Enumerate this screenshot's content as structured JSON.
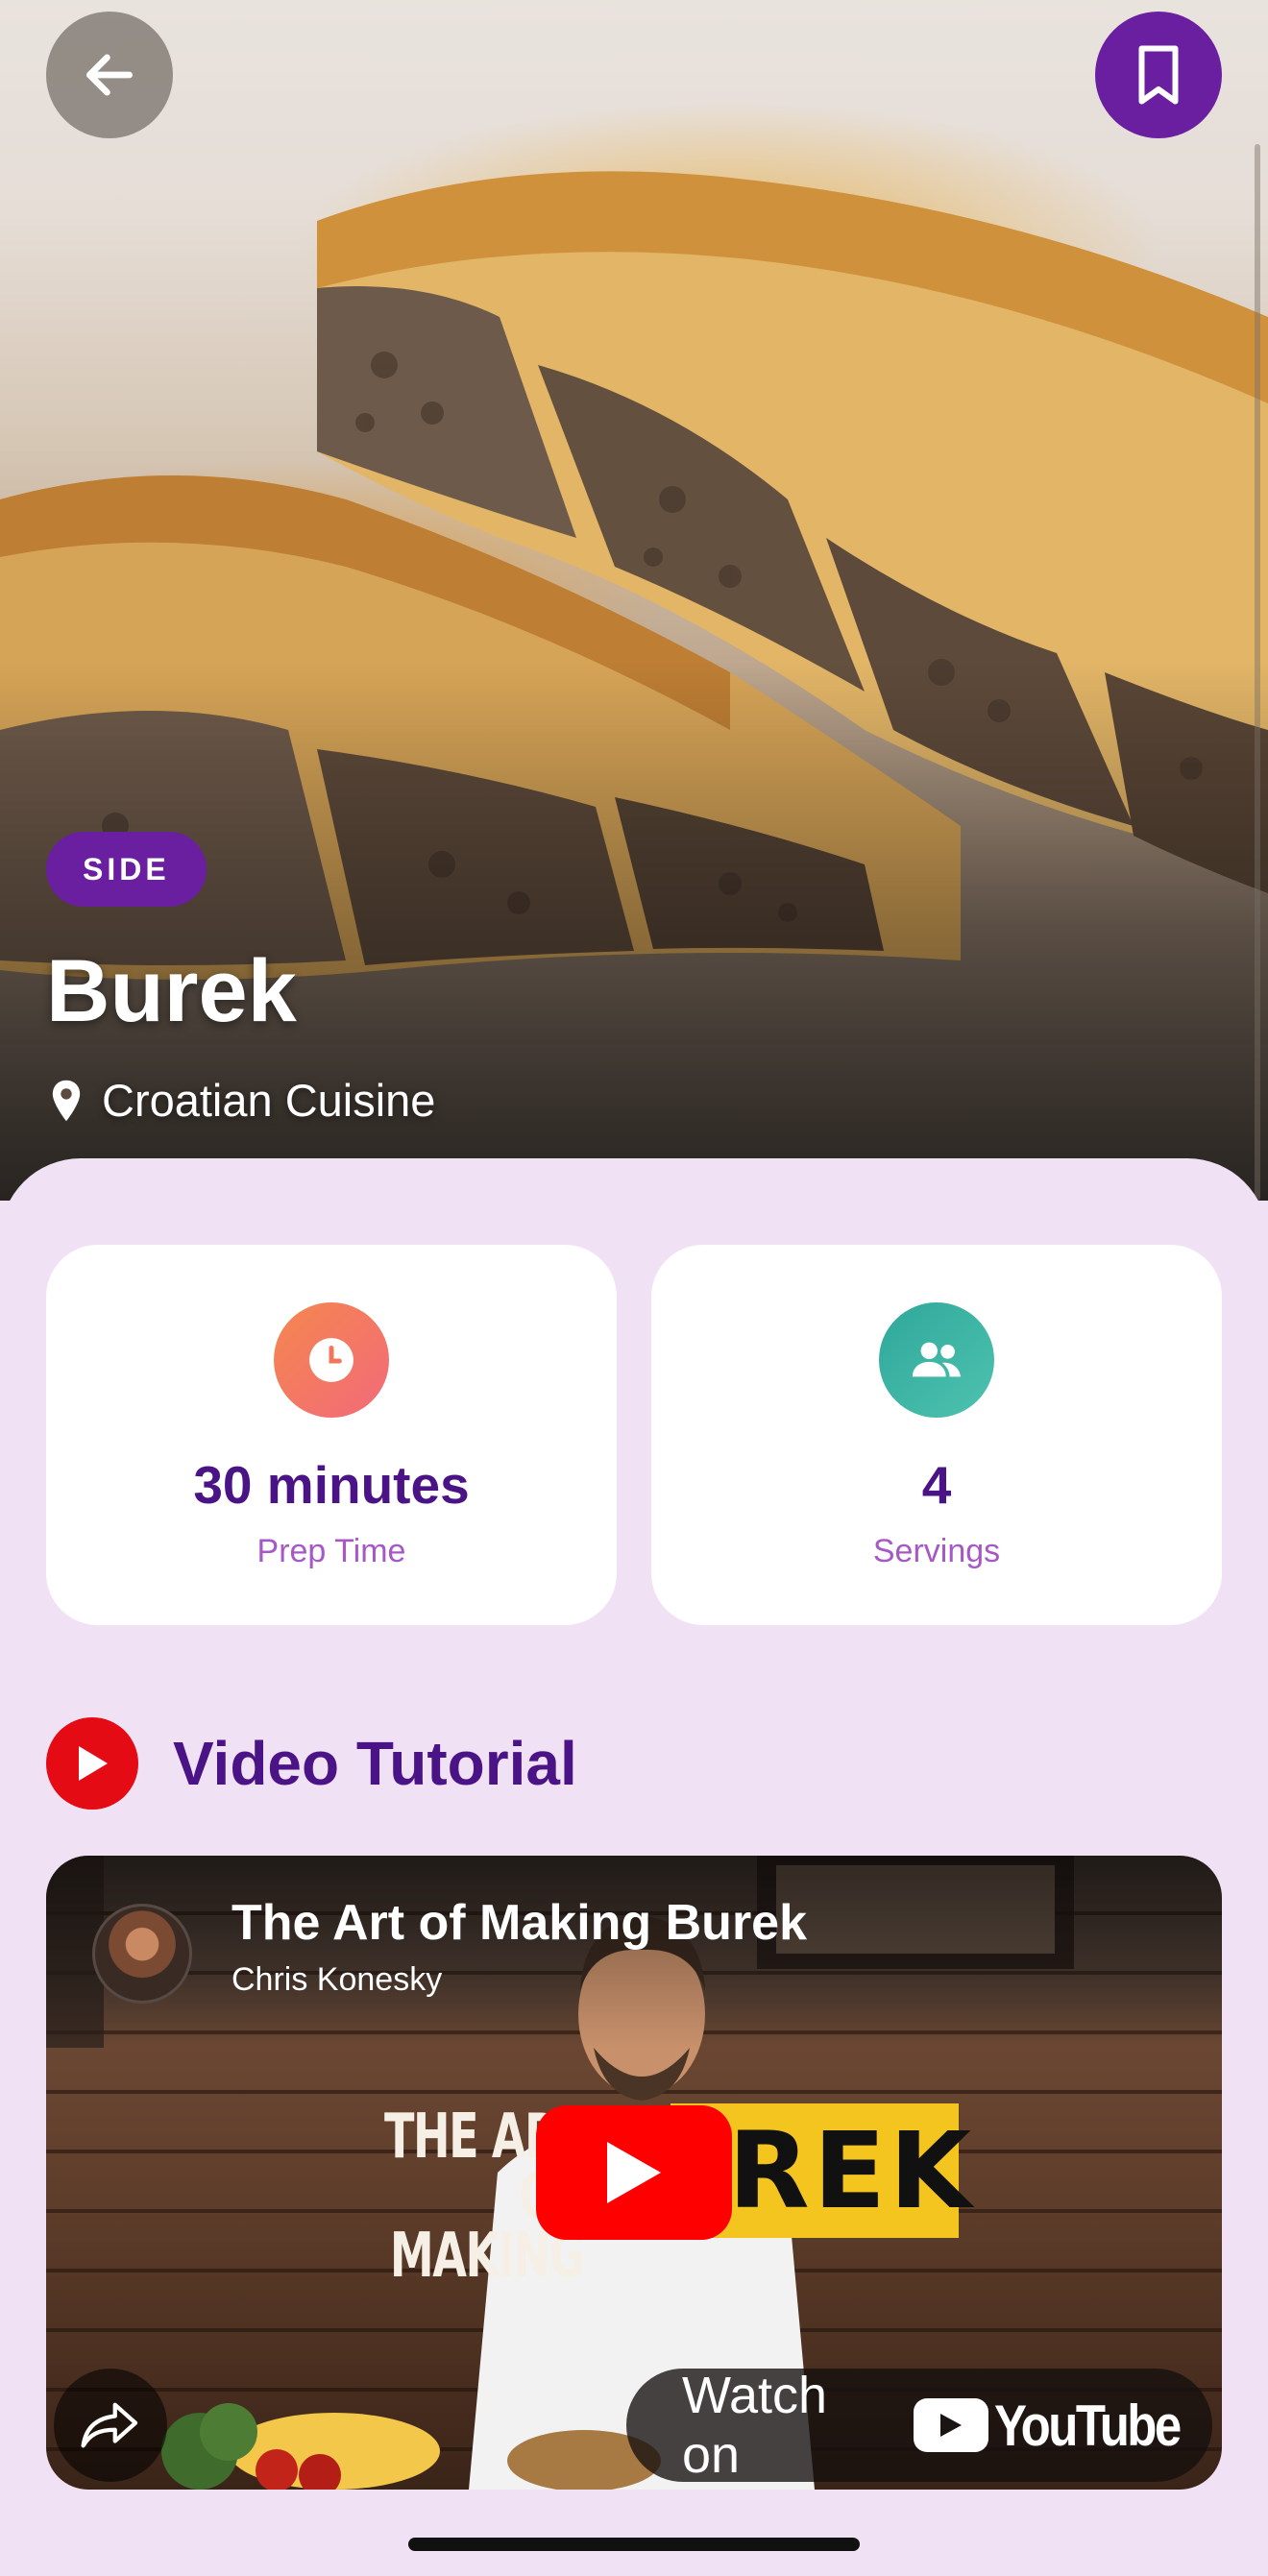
{
  "header": {
    "back_icon": "arrow-left-icon",
    "bookmark_icon": "bookmark-icon"
  },
  "recipe": {
    "category": "SIDE",
    "title": "Burek",
    "cuisine": "Croatian Cuisine",
    "location_icon": "map-pin-icon"
  },
  "stats": {
    "prep_time": {
      "value": "30 minutes",
      "label": "Prep Time",
      "icon": "clock-icon"
    },
    "servings": {
      "value": "4",
      "label": "Servings",
      "icon": "people-icon"
    }
  },
  "video_section": {
    "title": "Video Tutorial",
    "icon": "youtube-play-icon"
  },
  "video": {
    "title": "The Art of Making Burek",
    "channel": "Chris Konesky",
    "thumbnail_text_left": "THE ART OF MAKING",
    "thumbnail_text_right": "REK",
    "watch_label": "Watch on",
    "platform_name": "YouTube",
    "share_icon": "share-icon",
    "play_icon": "play-icon"
  },
  "colors": {
    "accent": "#6a1fa0",
    "heading": "#4a1486",
    "label": "#a659c6",
    "background": "#f1e1f4",
    "youtube_red": "#e40b15"
  }
}
